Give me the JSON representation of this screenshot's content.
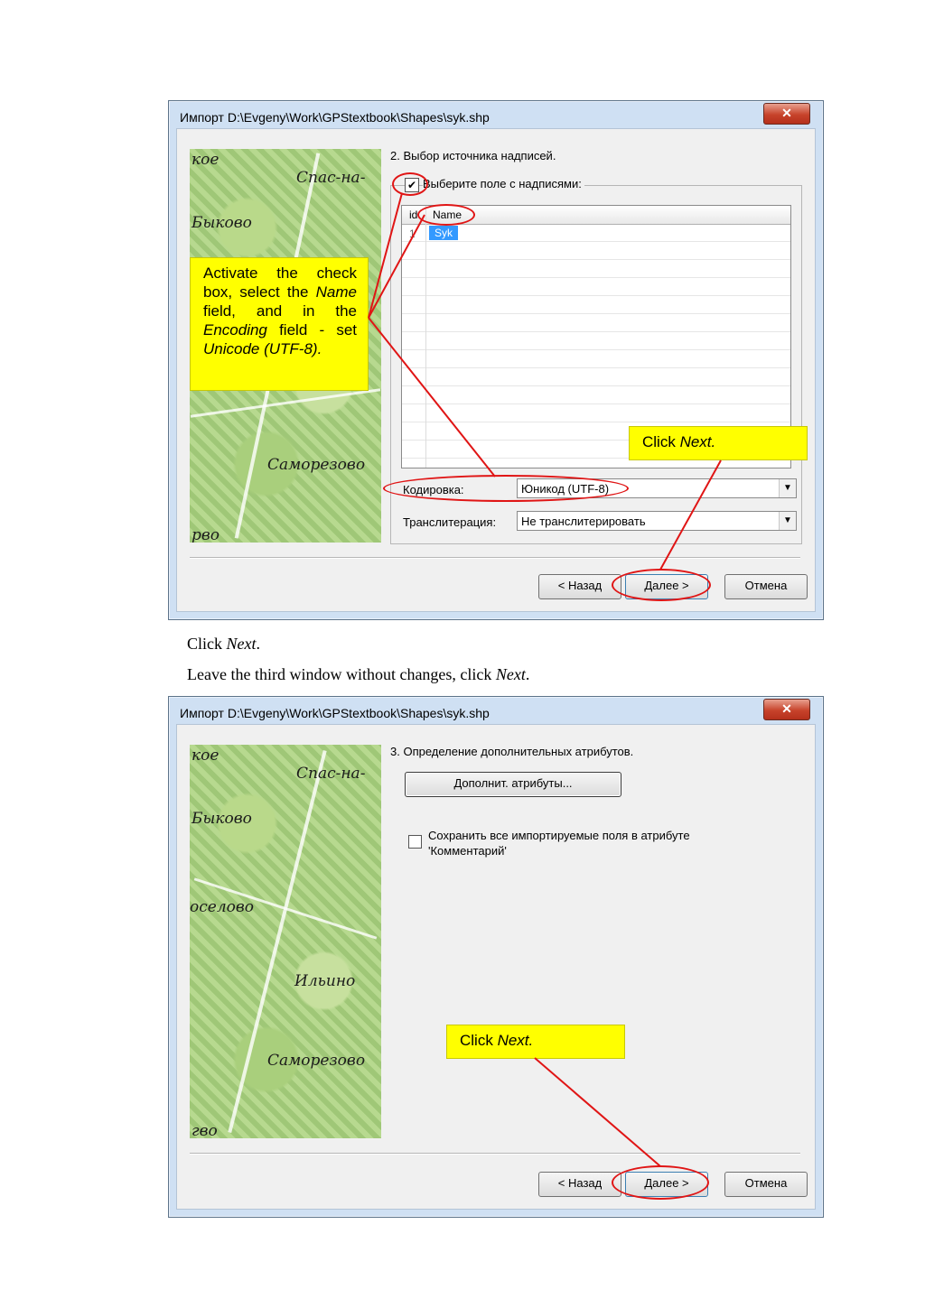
{
  "dialog1": {
    "title": "Импорт D:\\Evgeny\\Work\\GPStextbook\\Shapes\\syk.shp",
    "close": "✕",
    "step": "2. Выбор источника надписей.",
    "checkbox_label": "Выберите поле с надписями:",
    "checkbox_checked": true,
    "columns": [
      "id",
      "Name"
    ],
    "rows": [
      {
        "id": "1",
        "name": "Syk"
      }
    ],
    "encoding_label": "Кодировка:",
    "encoding_value": "Юникод (UTF-8)",
    "translit_label": "Транслитерация:",
    "translit_value": "Не транслитерировать",
    "back": "< Назад",
    "next": "Далее >",
    "cancel": "Отмена",
    "callout_main": {
      "t1": "Activate the check box, select the ",
      "name": "Name",
      "t2": " field, and in the ",
      "enc": "Encoding",
      "t3": " field - set ",
      "uni": "Unicode (UTF-8)."
    },
    "callout_next": {
      "t": "Click ",
      "em": "Next."
    }
  },
  "map_labels": {
    "a": "кое",
    "b": "Спас-на-",
    "c": "Быково",
    "d": "Саморезово",
    "e": "рво",
    "f": "оселово",
    "g": "Ильино",
    "h": "гво"
  },
  "text_between": {
    "line1_a": "Click ",
    "line1_em": "Next",
    "line1_b": ".",
    "line2_a": "Leave the third window without changes, click ",
    "line2_em": "Next",
    "line2_b": "."
  },
  "dialog2": {
    "title": "Импорт D:\\Evgeny\\Work\\GPStextbook\\Shapes\\syk.shp",
    "close": "✕",
    "step": "3. Определение дополнительных атрибутов.",
    "attr_button": "Дополнит. атрибуты...",
    "save_fields_l1": "Сохранить все импортируемые поля в атрибуте",
    "save_fields_l2": "'Комментарий'",
    "back": "< Назад",
    "next": "Далее >",
    "cancel": "Отмена",
    "callout_next": {
      "t": "Click ",
      "em": "Next."
    }
  },
  "colors": {
    "callout": "#ffff00",
    "highlight": "#e01515",
    "selection": "#3399ff"
  }
}
